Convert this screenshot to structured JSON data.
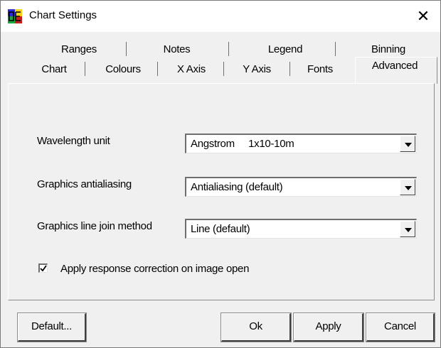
{
  "window": {
    "title": "Chart Settings",
    "close_glyph": "✕"
  },
  "tabs_back": [
    "Ranges",
    "Notes",
    "Legend",
    "Binning"
  ],
  "tabs_front": [
    "Chart",
    "Colours",
    "X Axis",
    "Y Axis",
    "Fonts",
    "Advanced"
  ],
  "active_tab": "Advanced",
  "settings": {
    "wavelength_label": "Wavelength unit",
    "wavelength_value": "Angstrom     1x10-10m",
    "antialiasing_label": "Graphics antialiasing",
    "antialiasing_value": "Antialiasing (default)",
    "linejoin_label": "Graphics line join method",
    "linejoin_value": "Line (default)",
    "response_correction_label": "Apply response correction on image open",
    "response_correction_checked": true
  },
  "buttons": {
    "default": "Default...",
    "ok": "Ok",
    "apply": "Apply",
    "cancel": "Cancel"
  }
}
